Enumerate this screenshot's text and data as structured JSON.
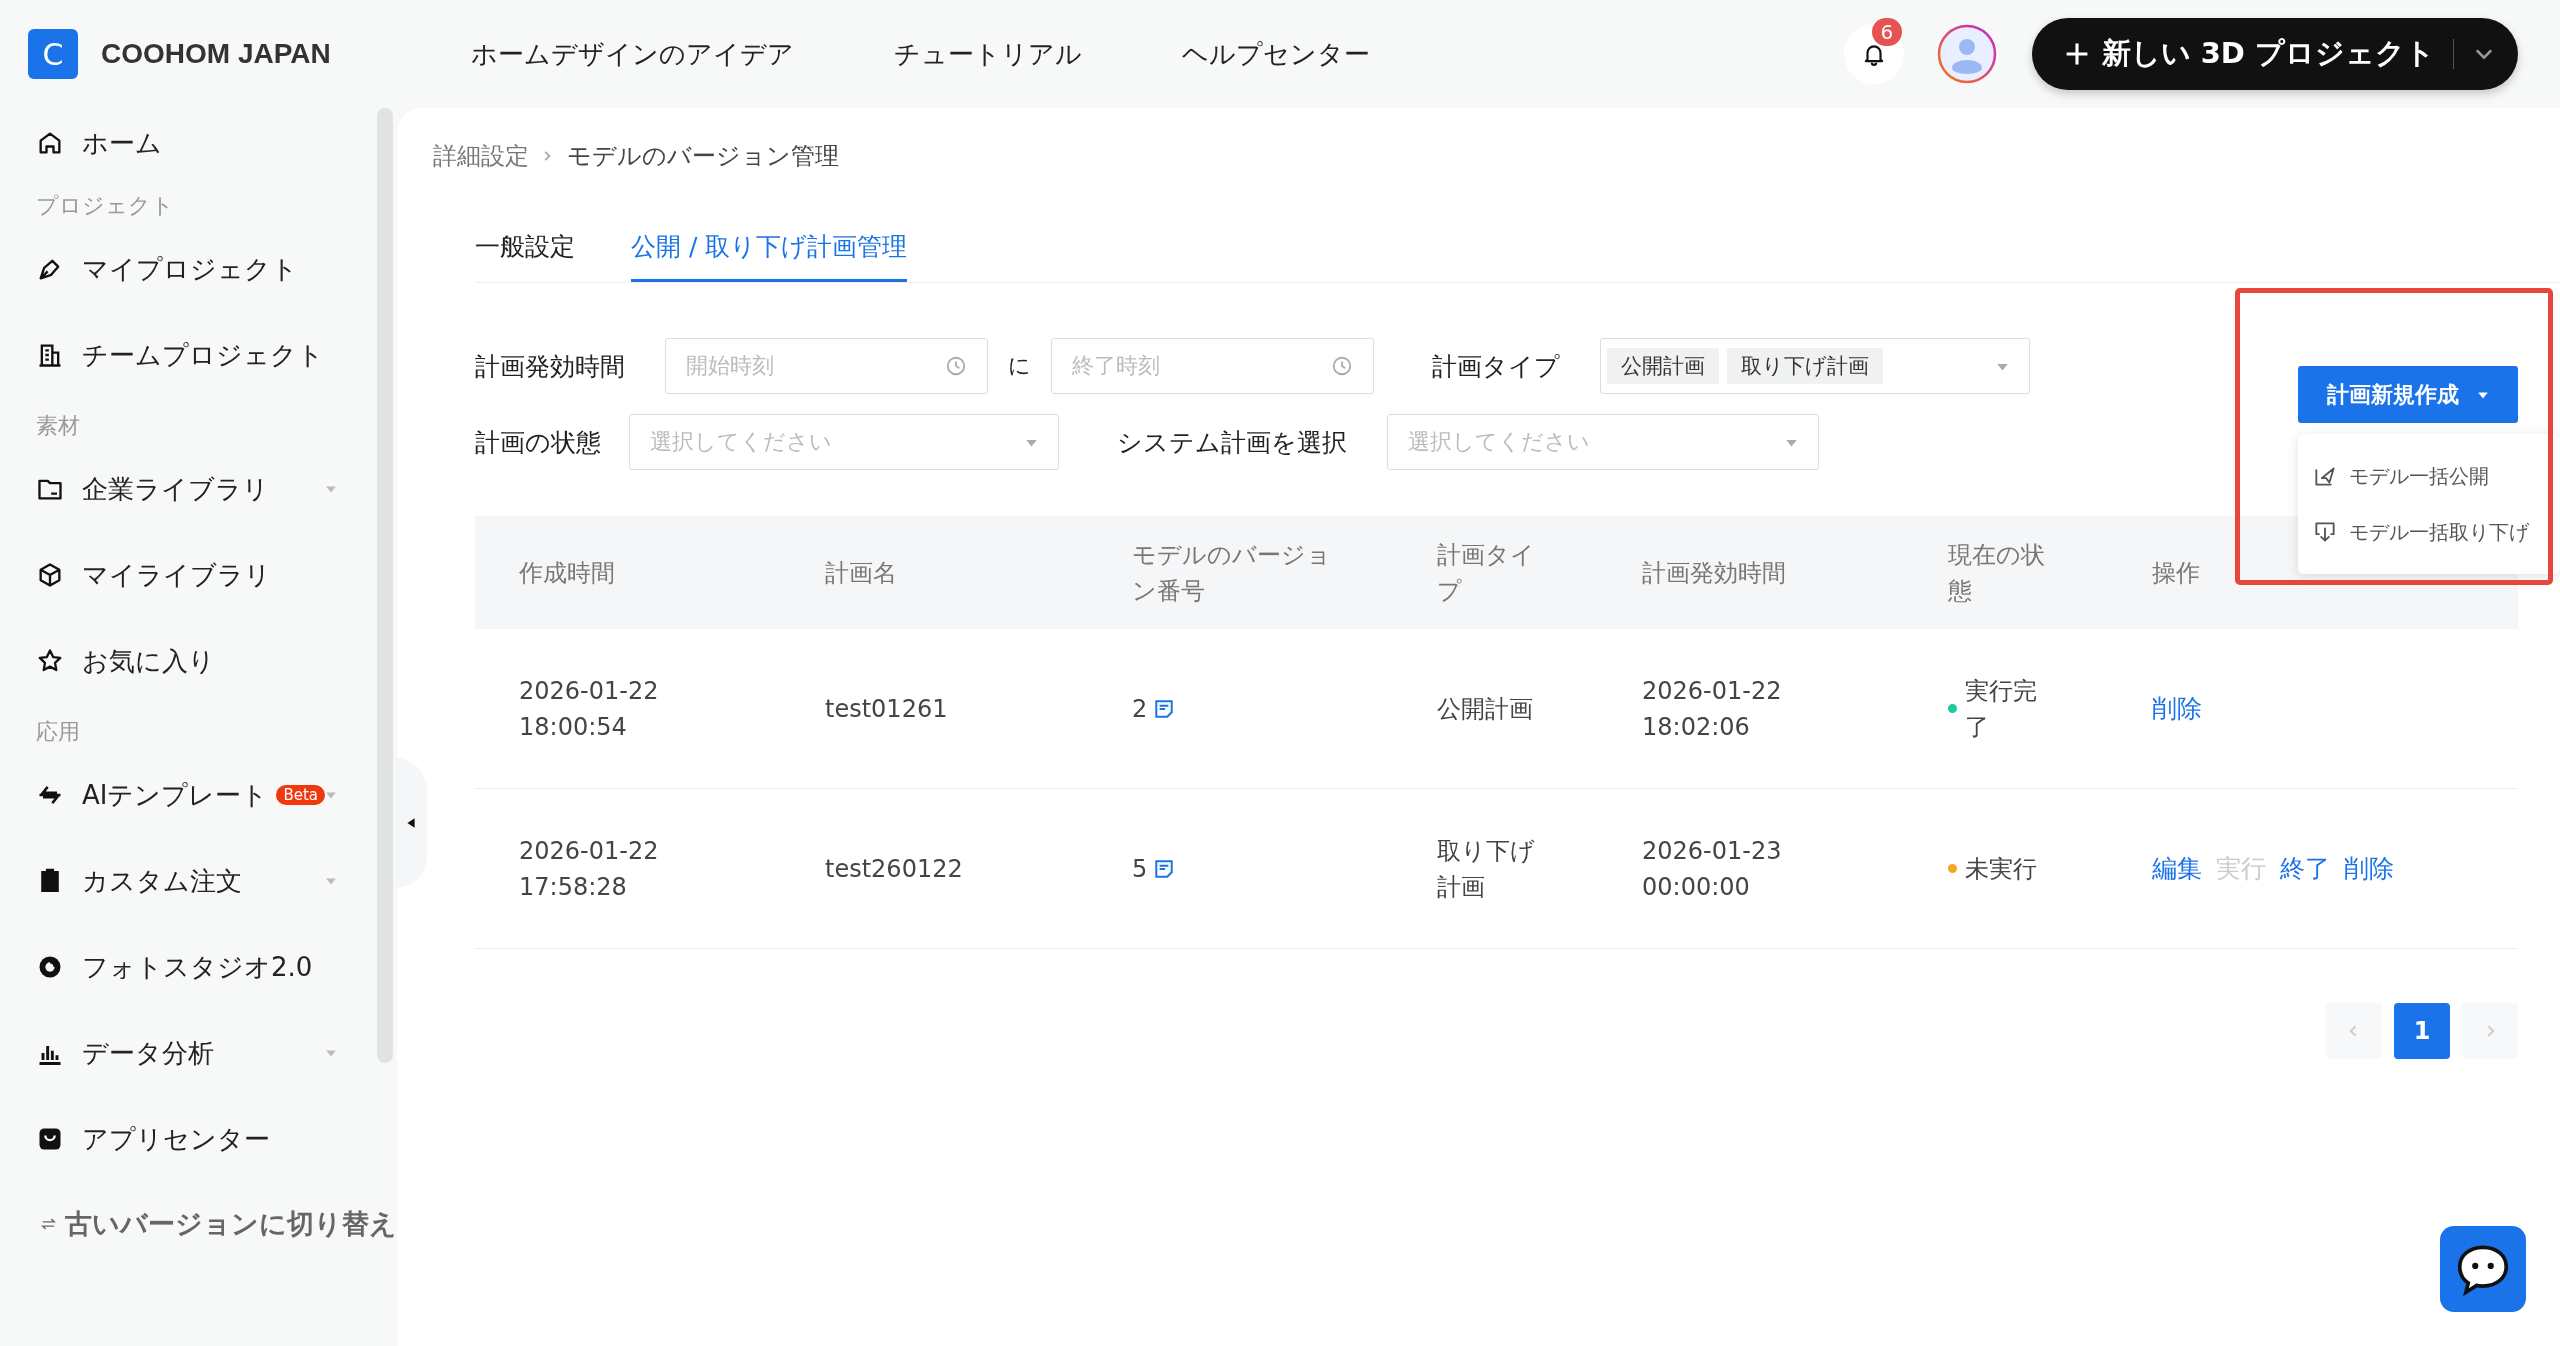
{
  "topbar": {
    "logo_letter": "C",
    "brand": "COOHOM JAPAN",
    "nav": [
      "ホームデザインのアイデア",
      "チュートリアル",
      "ヘルプセンター"
    ],
    "notification_count": "6",
    "create_button": "新しい 3D プロジェクト"
  },
  "sidebar": {
    "items": [
      {
        "kind": "item",
        "label": "ホーム",
        "expandable": false
      },
      {
        "kind": "heading",
        "label": "プロジェクト"
      },
      {
        "kind": "item",
        "label": "マイプロジェクト",
        "expandable": false
      },
      {
        "kind": "item",
        "label": "チームプロジェクト",
        "expandable": false
      },
      {
        "kind": "heading",
        "label": "素材"
      },
      {
        "kind": "item",
        "label": "企業ライブラリ",
        "expandable": true
      },
      {
        "kind": "item",
        "label": "マイライブラリ",
        "expandable": false
      },
      {
        "kind": "item",
        "label": "お気に入り",
        "expandable": false
      },
      {
        "kind": "heading",
        "label": "応用"
      },
      {
        "kind": "item",
        "label": "AIテンプレート",
        "badge": "Beta",
        "expandable": true
      },
      {
        "kind": "item",
        "label": "カスタム注文",
        "expandable": true
      },
      {
        "kind": "item",
        "label": "フォトスタジオ2.0",
        "expandable": false
      },
      {
        "kind": "item",
        "label": "データ分析",
        "expandable": true
      },
      {
        "kind": "item",
        "label": "アプリセンター",
        "expandable": false
      }
    ],
    "switch_version": "古いバージョンに切り替え"
  },
  "breadcrumb": [
    "詳細設定",
    "モデルのバージョン管理"
  ],
  "tabs": [
    {
      "label": "一般設定",
      "selected": false
    },
    {
      "label": "公開 / 取り下げ計画管理",
      "selected": true
    }
  ],
  "filters": {
    "effective_time_label": "計画発効時間",
    "start_placeholder": "開始時刻",
    "range_separator": "に",
    "end_placeholder": "終了時刻",
    "plan_type_label": "計画タイプ",
    "plan_type_tags": [
      "公開計画",
      "取り下げ計画"
    ],
    "status_label": "計画の状態",
    "status_placeholder": "選択してください",
    "system_plan_label": "システム計画を選択",
    "system_plan_placeholder": "選択してください"
  },
  "create_menu": {
    "button": "計画新規作成",
    "expanded": true,
    "highlighted": true,
    "items": [
      "モデル一括公開",
      "モデル一括取り下げ"
    ]
  },
  "table": {
    "columns": [
      "作成時間",
      "計画名",
      "モデルのバージョン番号",
      "計画タイプ",
      "計画発効時間",
      "現在の状態",
      "操作"
    ],
    "rows": [
      {
        "created": "2026-01-22 18:00:54",
        "name": "test01261",
        "version": "2",
        "type": "公開計画",
        "effective": "2026-01-22 18:02:06",
        "status": "実行完了",
        "color": "#1ec8a0",
        "actions": [
          {
            "label": "削除",
            "disabled": false
          }
        ]
      },
      {
        "created": "2026-01-22 17:58:28",
        "name": "test260122",
        "version": "5",
        "type": "取り下げ計画",
        "effective": "2026-01-23 00:00:00",
        "status": "未実行",
        "color": "#f5a623",
        "actions": [
          {
            "label": "編集",
            "disabled": false
          },
          {
            "label": "実行",
            "disabled": true
          },
          {
            "label": "終了",
            "disabled": false
          },
          {
            "label": "削除",
            "disabled": false
          }
        ]
      }
    ]
  },
  "pagination": {
    "pages": [
      {
        "label": "1",
        "selected": true
      }
    ],
    "prev_disabled": true,
    "next_disabled": true
  }
}
